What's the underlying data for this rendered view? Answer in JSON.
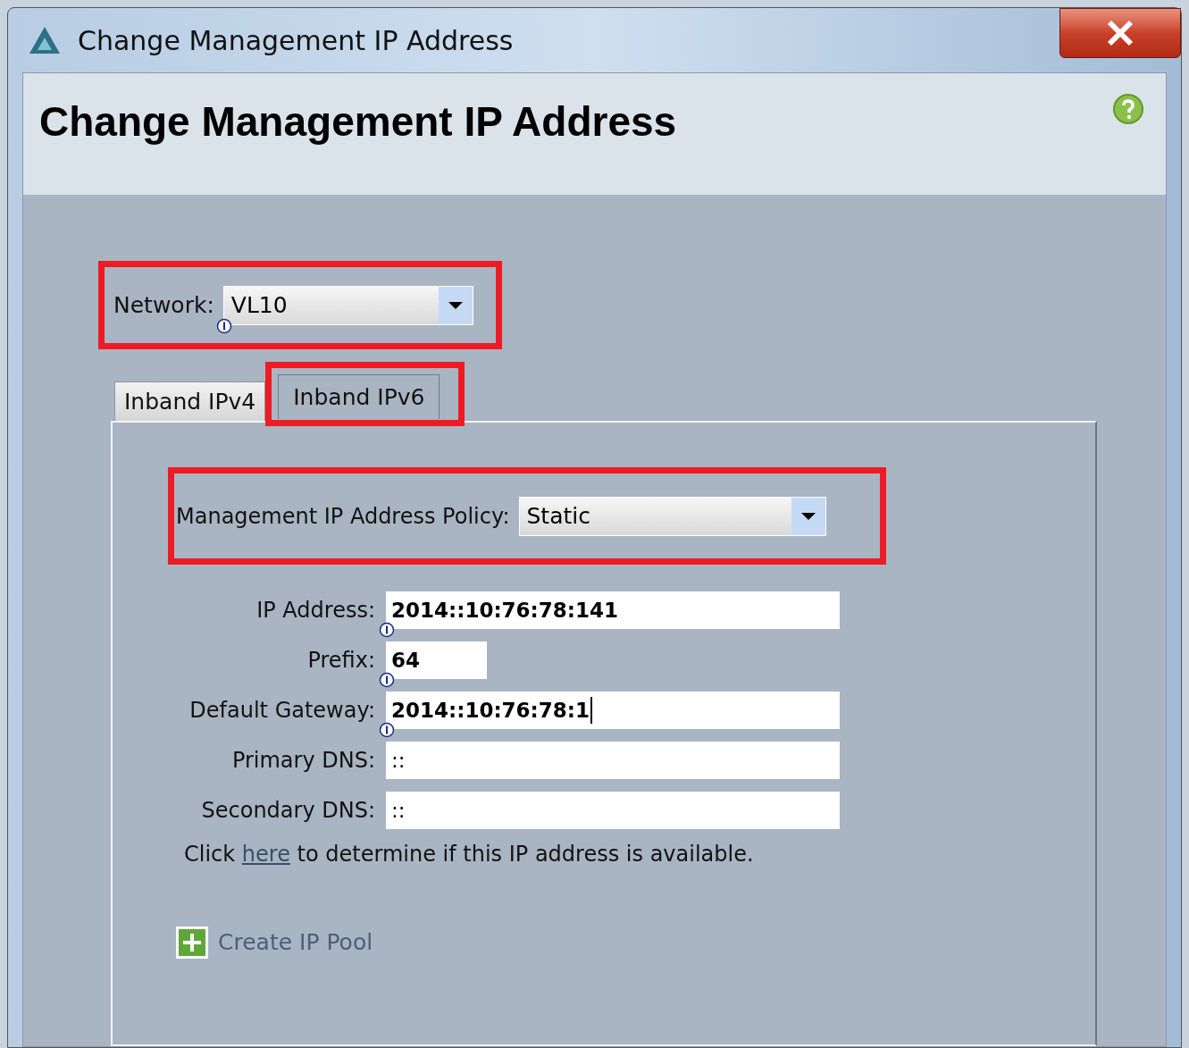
{
  "window": {
    "title": "Change Management IP Address"
  },
  "header": {
    "title": "Change Management IP Address"
  },
  "network": {
    "label": "Network:",
    "value": "VL10",
    "info": true
  },
  "tabs": [
    {
      "label": "Inband IPv4",
      "selected": false
    },
    {
      "label": "Inband IPv6",
      "selected": true
    }
  ],
  "policy": {
    "label": "Management IP Address Policy:",
    "value": "Static"
  },
  "fields": [
    {
      "label": "IP Address:",
      "value": "2014::10:76:78:141",
      "kind": "wide",
      "modified": true,
      "focused": false,
      "info": true
    },
    {
      "label": "Prefix:",
      "value": "64",
      "kind": "short",
      "modified": true,
      "focused": false,
      "info": true
    },
    {
      "label": "Default Gateway:",
      "value": "2014::10:76:78:1",
      "kind": "wide",
      "modified": true,
      "focused": true,
      "info": true
    },
    {
      "label": "Primary DNS:",
      "value": "::",
      "kind": "wide",
      "modified": false,
      "focused": false,
      "info": false
    },
    {
      "label": "Secondary DNS:",
      "value": "::",
      "kind": "wide",
      "modified": false,
      "focused": false,
      "info": false
    }
  ],
  "availability_note": {
    "before": "Click",
    "link": "here",
    "after": "to determine if this IP address is available."
  },
  "create_pool": {
    "label": "Create IP Pool"
  }
}
